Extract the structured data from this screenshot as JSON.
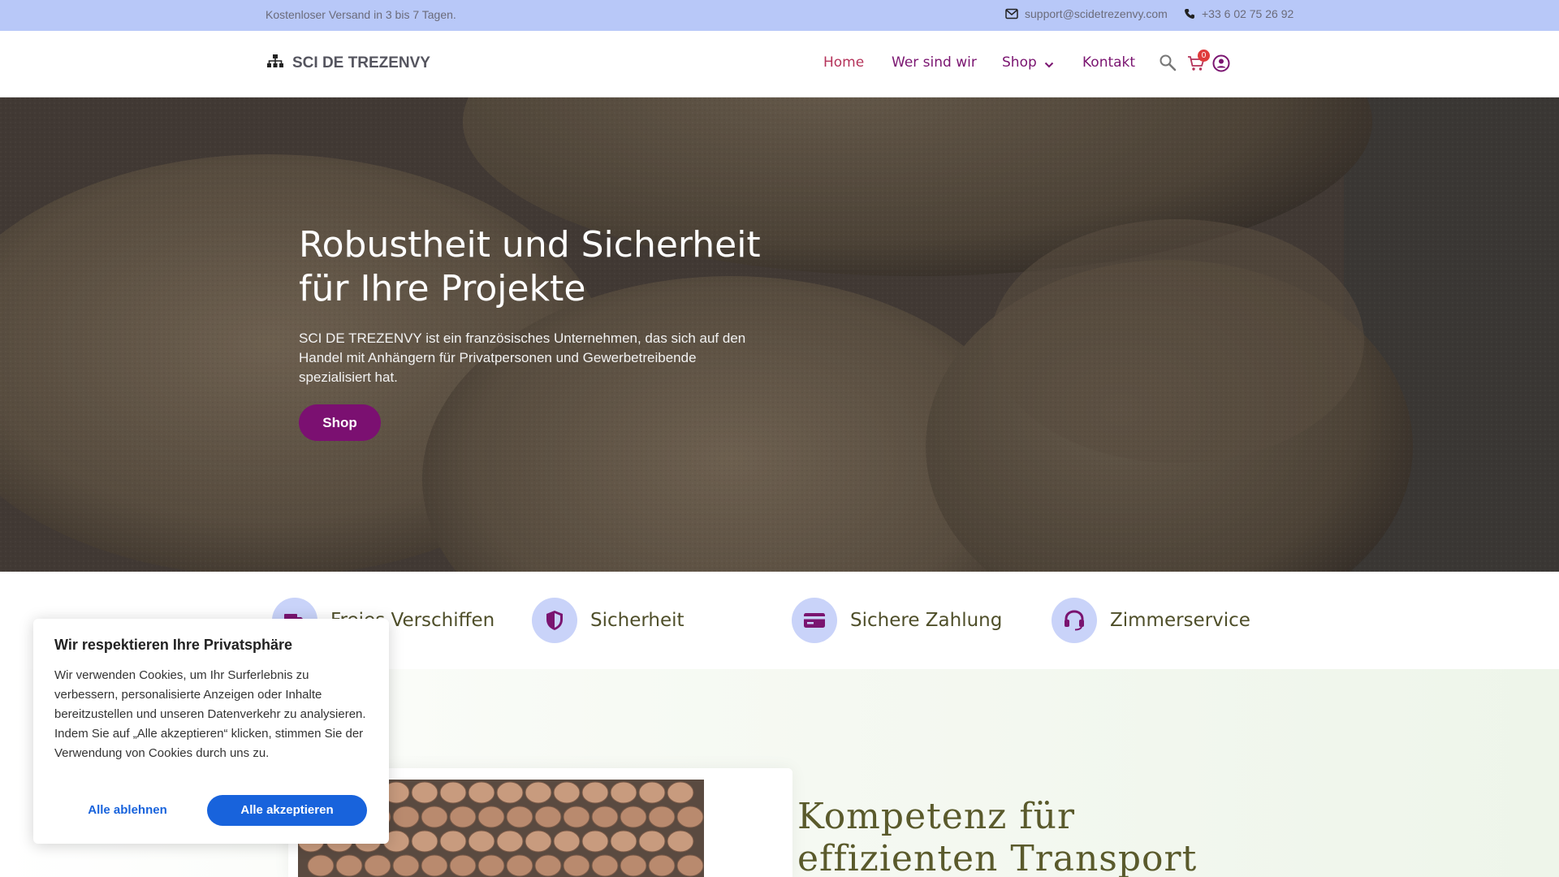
{
  "topbar": {
    "shipping_note": "Kostenloser Versand in 3 bis 7 Tagen.",
    "email": "support@scidetrezenvy.com",
    "phone": "+33 6 02 75 26 92"
  },
  "header": {
    "logo_text": "SCI DE TREZENVY",
    "nav": {
      "home": "Home",
      "about": "Wer sind wir",
      "shop": "Shop",
      "contact": "Kontakt"
    },
    "cart_count": "0"
  },
  "hero": {
    "title": "Robustheit und Sicherheit für Ihre Projekte",
    "text": "SCI DE TREZENVY ist ein französisches Unternehmen, das sich auf den Handel mit Anhängern für Privatpersonen und Gewerbetreibende spezialisiert hat.",
    "button": "Shop"
  },
  "features": [
    {
      "label": "Freies Verschiffen",
      "icon": "truck-icon"
    },
    {
      "label": "Sicherheit",
      "icon": "shield-icon"
    },
    {
      "label": "Sichere Zahlung",
      "icon": "credit-card-icon"
    },
    {
      "label": "Zimmerservice",
      "icon": "headset-icon"
    }
  ],
  "lower": {
    "title": "Kompetenz für effizienten Transport"
  },
  "cookie": {
    "title": "Wir respektieren Ihre Privatsphäre",
    "text": "Wir verwenden Cookies, um Ihr Surferlebnis zu verbessern, personalisierte Anzeigen oder Inhalte bereitzustellen und unseren Datenverkehr zu analysieren. Indem Sie auf „Alle akzeptieren“ klicken, stimmen Sie der Verwendung von Cookies durch uns zu.",
    "reject": "Alle ablehnen",
    "accept": "Alle akzeptieren"
  },
  "colors": {
    "topbar_bg": "#b8c8f8",
    "nav_text": "#7a1470",
    "nav_active": "#b5335a",
    "primary_button": "#7b1071",
    "feature_circle": "#c9d3f9",
    "cookie_button": "#1863dc"
  }
}
